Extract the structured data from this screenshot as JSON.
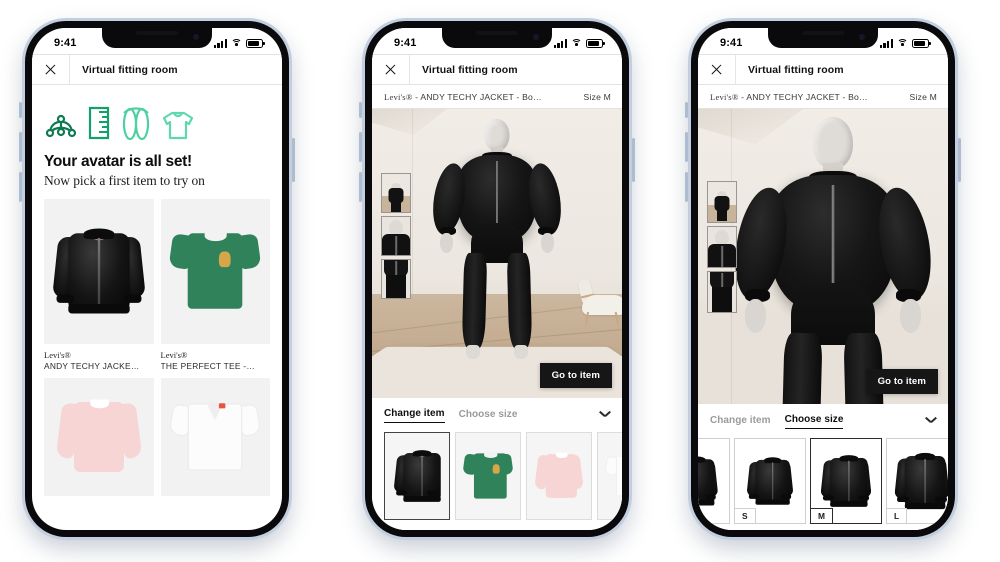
{
  "meta": {
    "app_title": "Virtual fitting room",
    "accent_dark": "#161616",
    "brand_green_1": "#0e7a52",
    "brand_green_2": "#13a06a",
    "brand_green_3": "#4fd0a0",
    "brand_green_4": "#5fd8b0"
  },
  "status_bar": {
    "time": "9:41",
    "signal": "cellular-signal-icon",
    "wifi": "wifi-icon",
    "battery": "battery-icon"
  },
  "header": {
    "close_label": "close-icon",
    "title": "Virtual fitting room"
  },
  "product_bar": {
    "brand": "Levi's®",
    "separator": " - ",
    "name": "ANDY TECHY JACKET - Bo…",
    "size_label": "Size M"
  },
  "phone1": {
    "icons": [
      "avatar-node-icon",
      "ruler-icon",
      "thread-spiral-icon",
      "sweater-icon"
    ],
    "heading": "Your avatar is all set!",
    "subheading": "Now pick a first item to try on",
    "catalog": [
      {
        "brand": "Levi's®",
        "name": "ANDY TECHY JACKE…",
        "art": "bomber"
      },
      {
        "brand": "Levi's®",
        "name": "THE PERFECT TEE -…",
        "art": "tee"
      },
      {
        "brand": "",
        "name": "",
        "art": "sweat"
      },
      {
        "brand": "",
        "name": "",
        "art": "vtee"
      }
    ]
  },
  "phone2": {
    "thumbnails": [
      "avatar-full-body-thumb",
      "avatar-upper-body-thumb",
      "avatar-lower-body-thumb"
    ],
    "cta": "Go to item",
    "tabs": [
      {
        "label": "Change item",
        "active": true
      },
      {
        "label": "Choose size",
        "active": false
      }
    ],
    "chevron": "chevron-down-icon",
    "items": [
      {
        "art": "bomber",
        "selected": true
      },
      {
        "art": "tee",
        "selected": false
      },
      {
        "art": "sweat",
        "selected": false
      },
      {
        "art": "vtee",
        "selected": false
      }
    ]
  },
  "phone3": {
    "thumbnails": [
      "avatar-full-body-thumb",
      "avatar-upper-body-thumb",
      "avatar-lower-body-thumb"
    ],
    "cta": "Go to item",
    "tabs": [
      {
        "label": "Change item",
        "active": false
      },
      {
        "label": "Choose size",
        "active": true
      }
    ],
    "chevron": "chevron-down-icon",
    "sizes": [
      {
        "label": "",
        "selected": false
      },
      {
        "label": "S",
        "selected": false
      },
      {
        "label": "M",
        "selected": true
      },
      {
        "label": "L",
        "selected": false
      }
    ]
  }
}
